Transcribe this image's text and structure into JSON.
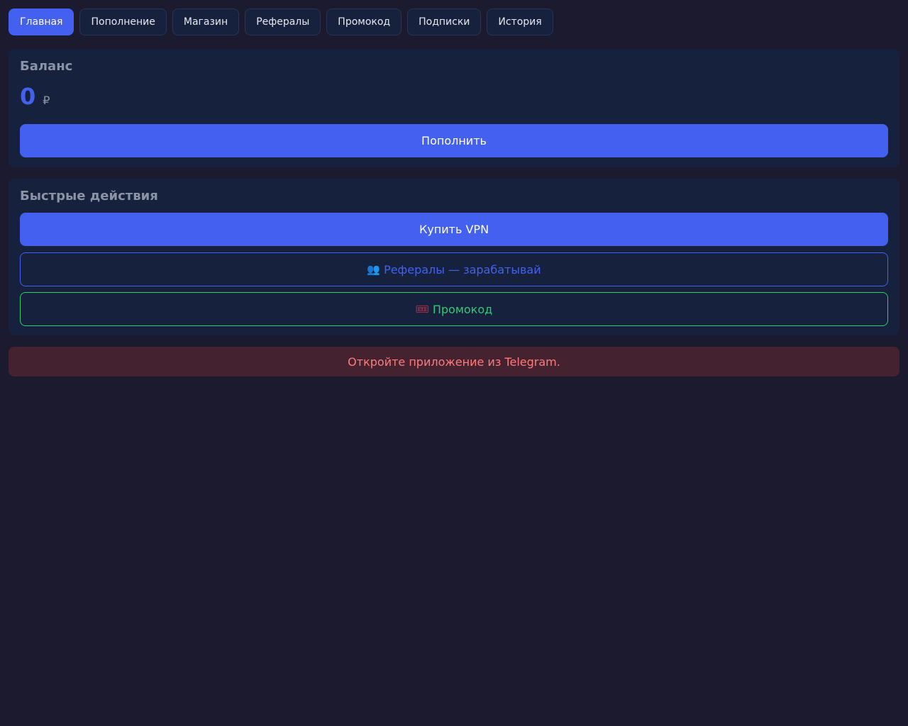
{
  "tabs": [
    {
      "label": "Главная",
      "active": true
    },
    {
      "label": "Пополнение",
      "active": false
    },
    {
      "label": "Магазин",
      "active": false
    },
    {
      "label": "Рефералы",
      "active": false
    },
    {
      "label": "Промокод",
      "active": false
    },
    {
      "label": "Подписки",
      "active": false
    },
    {
      "label": "История",
      "active": false
    }
  ],
  "balance": {
    "title": "Баланс",
    "amount": "0",
    "currency": "₽",
    "topup_label": "Пополнить"
  },
  "quick_actions": {
    "title": "Быстрые действия",
    "buy_vpn_label": "Купить VPN",
    "referrals_icon": "👥",
    "referrals_label": "Рефералы — зарабатывай",
    "promo_icon": "🎟",
    "promo_label": "Промокод"
  },
  "alert": {
    "text": "Откройте приложение из Telegram."
  },
  "colors": {
    "background": "#1b1a2e",
    "card": "#16213e",
    "accent": "#4361ee",
    "success": "#2ecc71",
    "error_text": "#ff7b7b",
    "error_bg": "#45222f"
  }
}
